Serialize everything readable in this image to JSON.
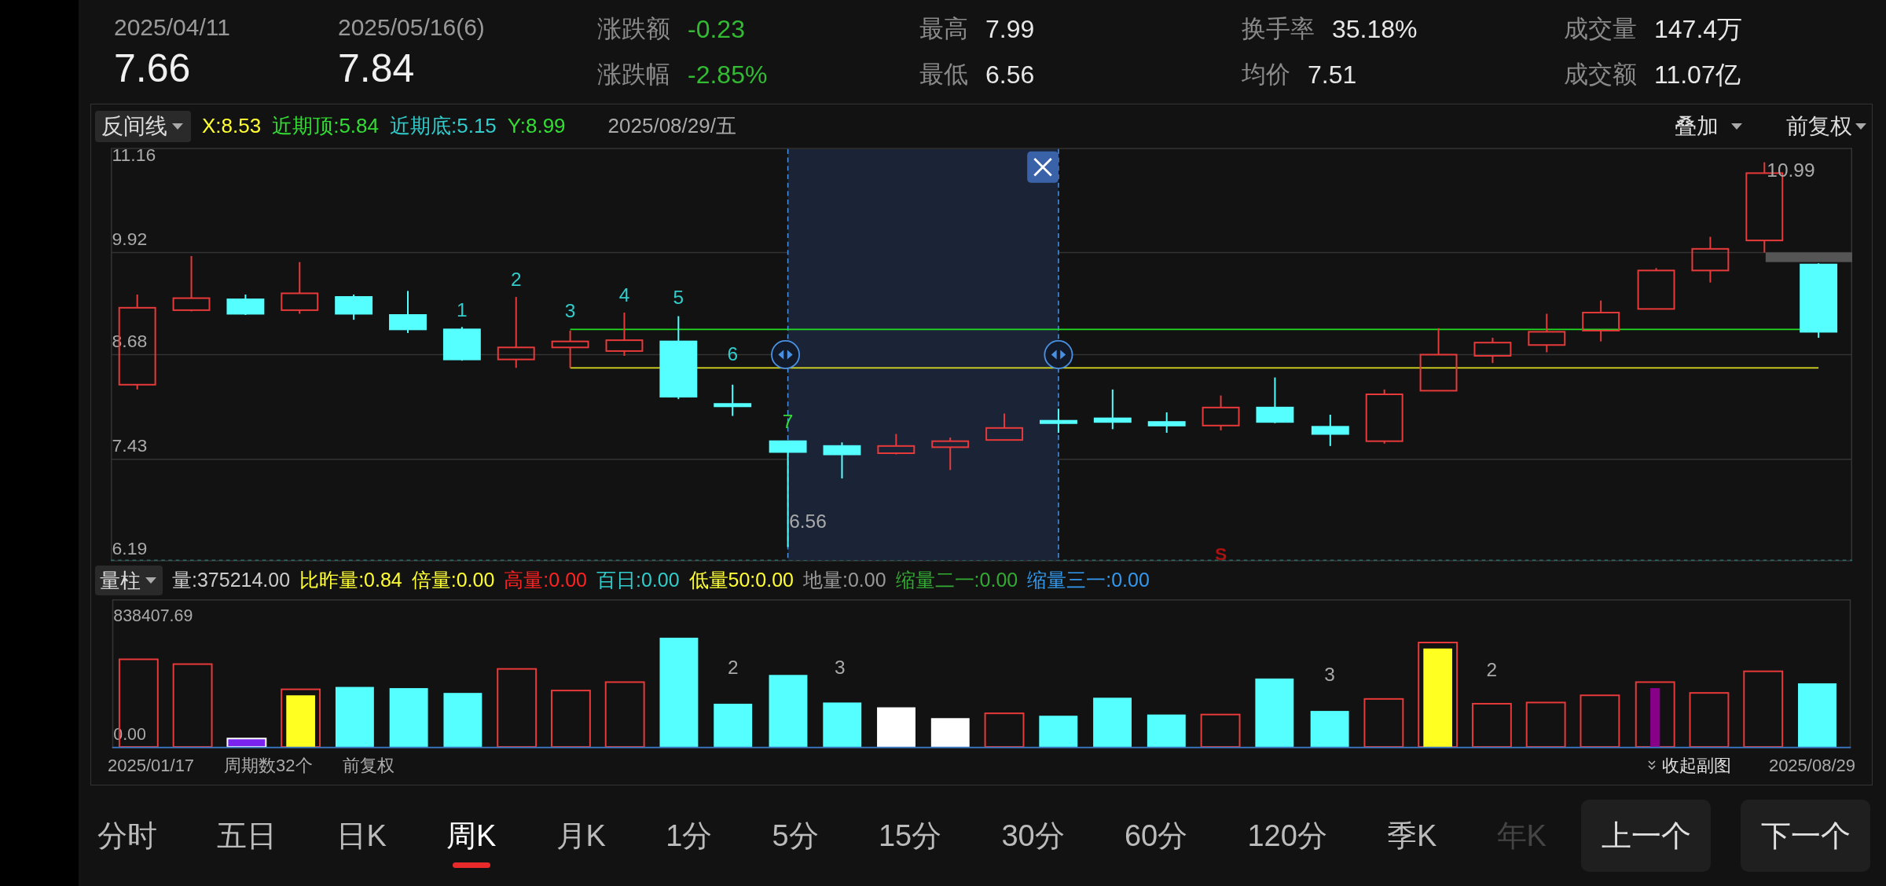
{
  "header": {
    "quotes": [
      {
        "date": "2025/04/11",
        "price": "7.66"
      },
      {
        "date": "2025/05/16(6)",
        "price": "7.84"
      }
    ],
    "stats": [
      {
        "label": "涨跌额",
        "value": "-0.23",
        "color": "#33bb33"
      },
      {
        "label": "涨跌幅",
        "value": "-2.85%",
        "color": "#33bb33"
      },
      {
        "label": "最高",
        "value": "7.99",
        "color": "#e8e8e8"
      },
      {
        "label": "最低",
        "value": "6.56",
        "color": "#e8e8e8"
      },
      {
        "label": "换手率",
        "value": "35.18%",
        "color": "#e8e8e8"
      },
      {
        "label": "均价",
        "value": "7.51",
        "color": "#e8e8e8"
      },
      {
        "label": "成交量",
        "value": "147.4万",
        "color": "#e8e8e8"
      },
      {
        "label": "成交额",
        "value": "11.07亿",
        "color": "#e8e8e8"
      }
    ]
  },
  "price_chart": {
    "indicator": "反间线",
    "readouts": [
      {
        "text": "X:8.53",
        "color": "#ffff33"
      },
      {
        "text": "近期顶:5.84",
        "color": "#33dd33"
      },
      {
        "text": "近期底:5.15",
        "color": "#33cccc"
      },
      {
        "text": "Y:8.99",
        "color": "#33dd33"
      }
    ],
    "date": "2025/08/29/五",
    "overlay": "叠加",
    "adjust": "前复权",
    "y_labels": [
      "11.16",
      "9.92",
      "8.68",
      "7.43",
      "6.19"
    ],
    "wave_labels": [
      {
        "text": "1",
        "color": "#33cccc"
      },
      {
        "text": "2",
        "color": "#33cccc"
      },
      {
        "text": "3",
        "color": "#33cccc"
      },
      {
        "text": "4",
        "color": "#33cccc"
      },
      {
        "text": "5",
        "color": "#33cccc"
      },
      {
        "text": "6",
        "color": "#33cccc"
      },
      {
        "text": "7",
        "color": "#33dd33"
      }
    ],
    "low_label": "6.56",
    "high_label": "10.99",
    "signal": "S"
  },
  "volume_chart": {
    "indicator": "量柱",
    "readouts": [
      {
        "text": "量:375214.00",
        "color": "#cccccc"
      },
      {
        "text": "比昨量:0.84",
        "color": "#ffff33"
      },
      {
        "text": "倍量:0.00",
        "color": "#ffff33"
      },
      {
        "text": "高量:0.00",
        "color": "#ff2222"
      },
      {
        "text": "百日:0.00",
        "color": "#33cccc"
      },
      {
        "text": "低量50:0.00",
        "color": "#ffff33"
      },
      {
        "text": "地量:0.00",
        "color": "#999999"
      },
      {
        "text": "缩量二一:0.00",
        "color": "#33aa33"
      },
      {
        "text": "缩量三一:0.00",
        "color": "#3399ee"
      }
    ],
    "y_labels": [
      "838407.69",
      "0.00"
    ],
    "bar_labels": [
      "2",
      "3",
      "3",
      "2"
    ]
  },
  "footer": {
    "start": "2025/01/17",
    "count": "周期数32个",
    "adjust": "前复权",
    "collapse": "收起副图",
    "end": "2025/08/29"
  },
  "tabs": [
    {
      "label": "分时",
      "selected": false,
      "dimmed": false
    },
    {
      "label": "五日",
      "selected": false,
      "dimmed": false
    },
    {
      "label": "日K",
      "selected": false,
      "dimmed": false
    },
    {
      "label": "周K",
      "selected": true,
      "dimmed": false
    },
    {
      "label": "月K",
      "selected": false,
      "dimmed": false
    },
    {
      "label": "1分",
      "selected": false,
      "dimmed": false
    },
    {
      "label": "5分",
      "selected": false,
      "dimmed": false
    },
    {
      "label": "15分",
      "selected": false,
      "dimmed": false
    },
    {
      "label": "30分",
      "selected": false,
      "dimmed": false
    },
    {
      "label": "60分",
      "selected": false,
      "dimmed": false
    },
    {
      "label": "120分",
      "selected": false,
      "dimmed": false
    },
    {
      "label": "季K",
      "selected": false,
      "dimmed": false
    },
    {
      "label": "年K",
      "selected": false,
      "dimmed": true
    }
  ],
  "buttons": [
    "上一个",
    "下一个"
  ]
}
